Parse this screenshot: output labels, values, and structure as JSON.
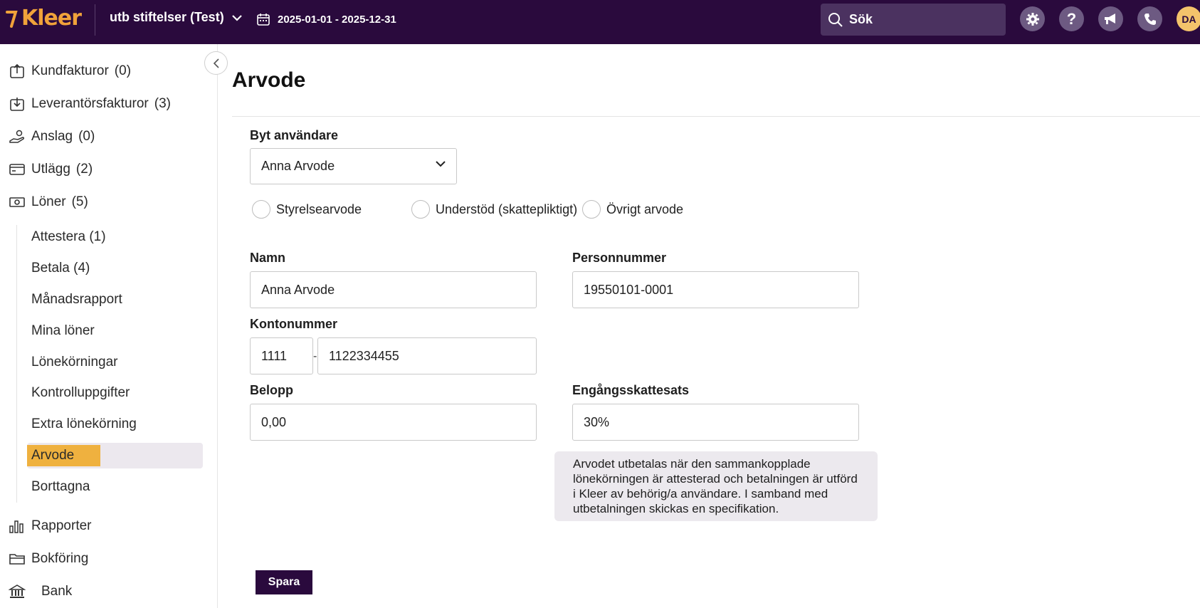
{
  "header": {
    "logo_text": "Kleer",
    "org_name": "utb stiftelser (Test)",
    "period": "2025-01-01 - 2025-12-31",
    "search_label": "Sök",
    "avatar_initials": "DA",
    "icons": [
      "gear-icon",
      "help-icon",
      "megaphone-icon",
      "phone-icon"
    ],
    "colors": {
      "bar": "#2a0a3d",
      "accent": "#f0a23a"
    }
  },
  "sidebar": {
    "items": [
      {
        "label": "Kundfakturor",
        "count": "(0)",
        "icon": "invoice-out-icon"
      },
      {
        "label": "Leverantörsfakturor",
        "count": "(3)",
        "icon": "invoice-in-icon"
      },
      {
        "label": "Anslag",
        "count": "(0)",
        "icon": "grant-hand-icon"
      },
      {
        "label": "Utlägg",
        "count": "(2)",
        "icon": "card-icon"
      },
      {
        "label": "Löner",
        "count": "(5)",
        "icon": "cash-icon"
      }
    ],
    "sub_items": [
      "Attestera (1)",
      "Betala (4)",
      "Månadsrapport",
      "Mina löner",
      "Lönekörningar",
      "Kontrolluppgifter",
      "Extra lönekörning",
      "Arvode",
      "Borttagna"
    ],
    "active_sub": "Arvode",
    "bottom_items": [
      {
        "label": "Rapporter",
        "icon": "bar-chart-icon"
      },
      {
        "label": "Bokföring",
        "icon": "folder-icon"
      },
      {
        "label": "Bank",
        "icon": "bank-icon"
      }
    ]
  },
  "main": {
    "title": "Arvode",
    "change_user": {
      "label": "Byt användare",
      "value": "Anna Arvode"
    },
    "fee_types": [
      "Styrelsearvode",
      "Understöd (skattepliktigt)",
      "Övrigt arvode"
    ],
    "name": {
      "label": "Namn",
      "value": "Anna Arvode"
    },
    "personal_number": {
      "label": "Personnummer",
      "value": "19550101-0001"
    },
    "account": {
      "label": "Kontonummer",
      "clearing": "1111",
      "separator": "-",
      "number": "1122334455"
    },
    "amount": {
      "label": "Belopp",
      "value": "0,00"
    },
    "tax_rate": {
      "label": "Engångsskattesats",
      "value": "30%"
    },
    "info": "Arvodet utbetalas när den sammankopplade lönekörningen är attesterad och betalningen är utförd i Kleer av behörig/a användare. I samband med utbetalningen skickas en specifikation.",
    "save_label": "Spara"
  }
}
